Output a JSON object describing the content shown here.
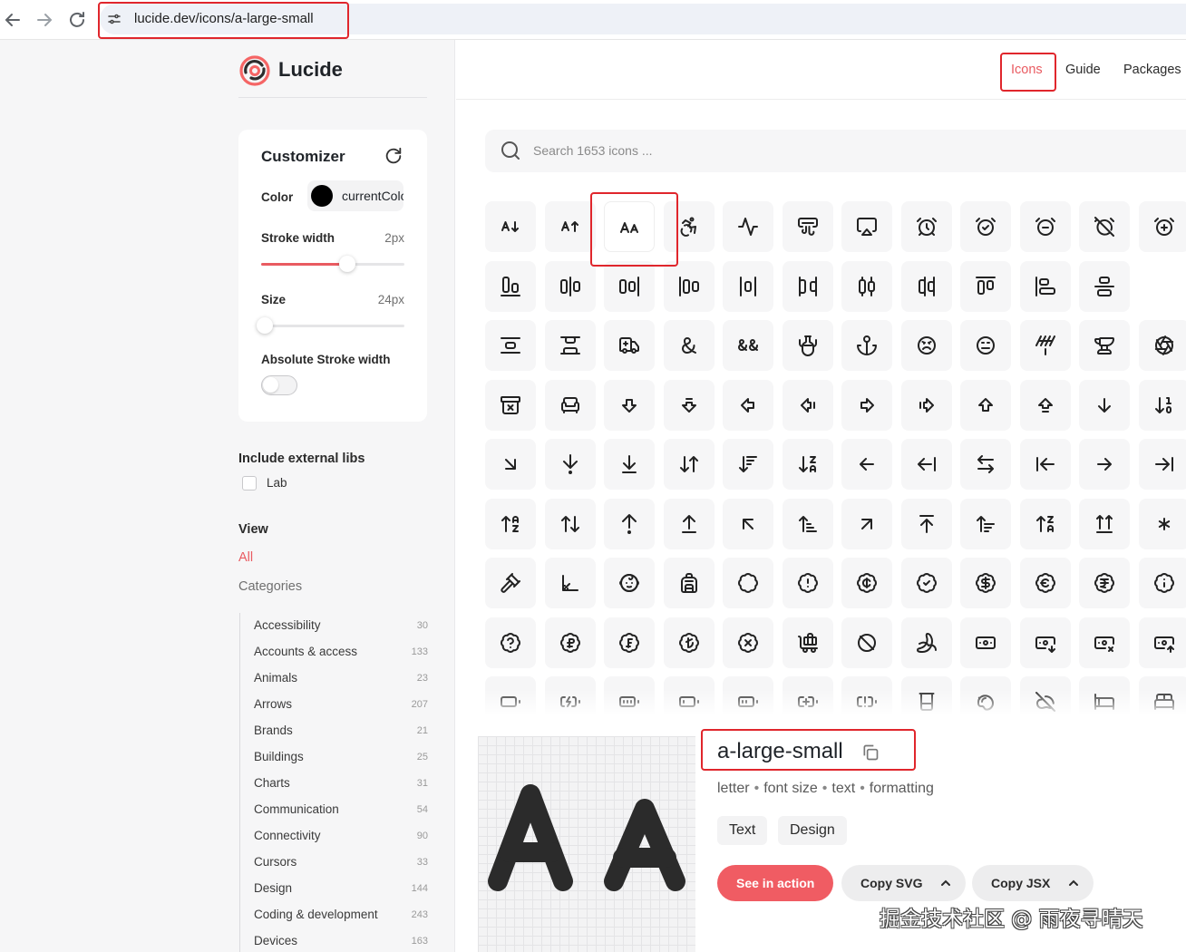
{
  "browser": {
    "url": "lucide.dev/icons/a-large-small"
  },
  "brand": {
    "name": "Lucide",
    "accent": "#e95b61"
  },
  "topnav": [
    {
      "label": "Icons",
      "active": true
    },
    {
      "label": "Guide",
      "active": false
    },
    {
      "label": "Packages",
      "active": false
    }
  ],
  "customizer": {
    "title": "Customizer",
    "color_label": "Color",
    "color_value": "currentColor",
    "stroke_label": "Stroke width",
    "stroke_value": "2px",
    "stroke_fraction": 0.6,
    "size_label": "Size",
    "size_value": "24px",
    "size_fraction": 0.0,
    "abs_label": "Absolute Stroke width",
    "abs_enabled": false
  },
  "external": {
    "title": "Include external libs",
    "lab_label": "Lab",
    "lab_checked": false
  },
  "view": {
    "title": "View",
    "all_label": "All",
    "categories_label": "Categories"
  },
  "categories": [
    {
      "name": "Accessibility",
      "count": "30"
    },
    {
      "name": "Accounts & access",
      "count": "133"
    },
    {
      "name": "Animals",
      "count": "23"
    },
    {
      "name": "Arrows",
      "count": "207"
    },
    {
      "name": "Brands",
      "count": "21"
    },
    {
      "name": "Buildings",
      "count": "25"
    },
    {
      "name": "Charts",
      "count": "31"
    },
    {
      "name": "Communication",
      "count": "54"
    },
    {
      "name": "Connectivity",
      "count": "90"
    },
    {
      "name": "Cursors",
      "count": "33"
    },
    {
      "name": "Design",
      "count": "144"
    },
    {
      "name": "Coding & development",
      "count": "243"
    },
    {
      "name": "Devices",
      "count": "163"
    }
  ],
  "search": {
    "placeholder": "Search 1653 icons ..."
  },
  "grid_icons": [
    [
      "a-arrow-down",
      "a-arrow-up",
      "a-large-small",
      "accessibility",
      "activity",
      "air-vent",
      "airplay",
      "alarm-clock",
      "alarm-clock-check",
      "alarm-clock-minus",
      "alarm-clock-off",
      "alarm-clock-plus"
    ],
    [
      "align-end-horizontal",
      "align-horizontal-justify-center",
      "align-horizontal-justify-end",
      "align-horizontal-justify-start",
      "align-horizontal-space-around",
      "align-horizontal-space-between",
      "align-horizontal-distribute-center",
      "align-horizontal-distribute-end",
      "align-start-vertical",
      "align-start-horizontal",
      "align-vertical-justify-center"
    ],
    [
      "align-vertical-space-around",
      "align-vertical-space-between",
      "ambulance",
      "ampersand",
      "ampersands",
      "amphora",
      "anchor",
      "angry",
      "annoyed",
      "antenna",
      "anvil",
      "aperture"
    ],
    [
      "archive-x",
      "armchair",
      "arrow-big-down",
      "arrow-big-down-dash",
      "arrow-big-left",
      "arrow-big-left-dash",
      "arrow-big-right",
      "arrow-big-right-dash",
      "arrow-big-up",
      "arrow-big-up-dash",
      "arrow-down",
      "arrow-down-1-0"
    ],
    [
      "arrow-down-right",
      "arrow-down-to-dot",
      "arrow-down-to-line",
      "arrow-down-up",
      "arrow-down-wide-narrow",
      "arrow-down-z-a",
      "arrow-left",
      "arrow-left-from-line",
      "arrow-left-right",
      "arrow-left-to-line",
      "arrow-right",
      "arrow-right-to-line"
    ],
    [
      "arrow-up-a-z",
      "arrow-up-down",
      "arrow-up-from-dot",
      "arrow-up-from-line",
      "arrow-up-left",
      "arrow-up-narrow-wide",
      "arrow-up-right",
      "arrow-up-to-line",
      "arrow-up-wide-narrow",
      "arrow-up-z-a",
      "arrows-up-from-line",
      "asterisk"
    ],
    [
      "gavel",
      "axis-3d",
      "baby",
      "backpack",
      "badge",
      "badge-alert",
      "badge-cent",
      "badge-check",
      "badge-dollar-sign",
      "badge-euro",
      "badge-indian-rupee",
      "badge-info"
    ],
    [
      "badge-help",
      "badge-russian-ruble",
      "badge-swiss-franc",
      "badge-turkish-lira",
      "badge-x",
      "baggage-claim",
      "ban",
      "banana",
      "banknote",
      "banknote-arrow-down",
      "banknote-x",
      "banknote-arrow-up"
    ],
    [
      "battery",
      "battery-charging",
      "battery-full",
      "battery-low",
      "battery-medium",
      "battery-plus",
      "battery-warning",
      "beaker",
      "bean",
      "bean-off",
      "bed",
      "bed-double"
    ]
  ],
  "detail": {
    "name": "a-large-small",
    "tags": [
      "letter",
      "font size",
      "text",
      "formatting"
    ],
    "chips": [
      "Text",
      "Design"
    ],
    "see_in_action": "See in action",
    "copy_svg": "Copy SVG",
    "copy_jsx": "Copy JSX"
  },
  "watermark": "掘金技术社区 @ 雨夜寻晴天",
  "highlight_color": "#e0262c"
}
